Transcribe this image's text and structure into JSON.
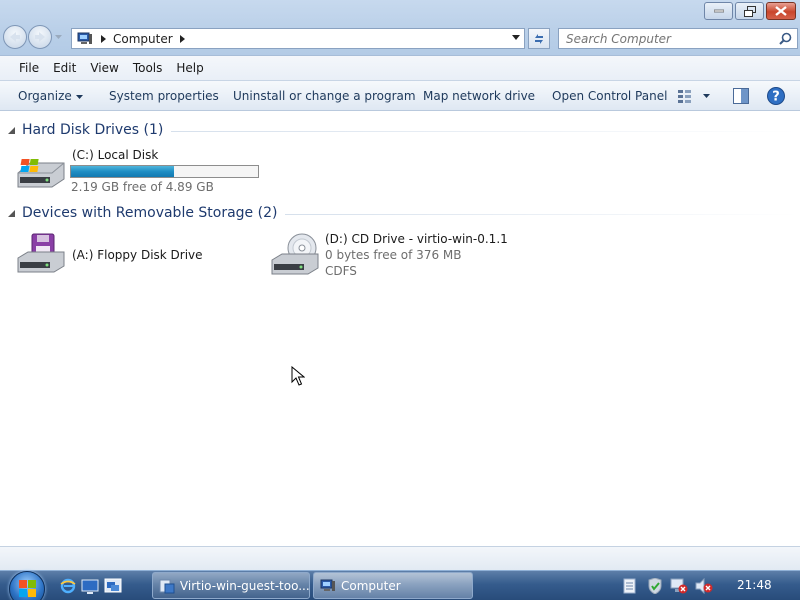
{
  "window": {
    "controls": [
      "minimize",
      "restore",
      "close"
    ]
  },
  "address_bar": {
    "crumbs": [
      "Computer"
    ]
  },
  "search": {
    "placeholder": "Search Computer"
  },
  "menu": [
    "File",
    "Edit",
    "View",
    "Tools",
    "Help"
  ],
  "command_bar": {
    "organize": "Organize",
    "system_properties": "System properties",
    "uninstall": "Uninstall or change a program",
    "map_drive": "Map network drive",
    "control_panel": "Open Control Panel"
  },
  "groups": {
    "hard_disks": {
      "title": "Hard Disk Drives (1)",
      "drives": [
        {
          "name": "(C:) Local Disk",
          "free": "2.19 GB free of 4.89 GB",
          "used_fraction": 0.552
        }
      ]
    },
    "removable": {
      "title": "Devices with Removable Storage (2)",
      "drives": [
        {
          "name": "(A:) Floppy Disk Drive"
        },
        {
          "name": "(D:) CD Drive - virtio-win-0.1.1",
          "free": "0 bytes free of 376 MB",
          "fs": "CDFS"
        }
      ]
    }
  },
  "taskbar": {
    "tasks": [
      {
        "label": "Virtio-win-guest-too..."
      },
      {
        "label": "Computer"
      }
    ],
    "clock": "21:48"
  },
  "colors": {
    "group_header": "#1e3a6e",
    "usage_fill": "#1f8ec4",
    "taskbar": "#355c8d"
  }
}
